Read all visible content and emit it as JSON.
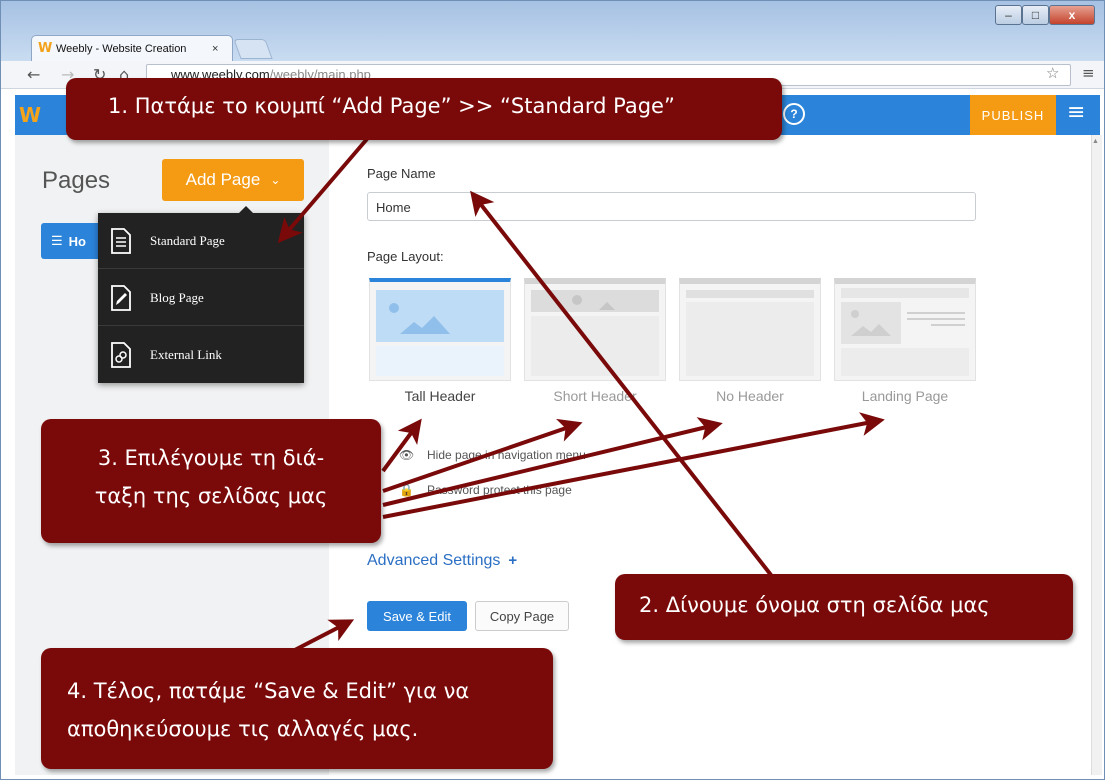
{
  "browser": {
    "tab_title": "Weebly - Website Creation",
    "tab_close": "×",
    "url_host": "www.weebly.com",
    "url_path": "/weebly/main.php",
    "window_controls": {
      "minimize": "–",
      "maximize": "□",
      "close": "x"
    }
  },
  "appbar": {
    "logo": "W",
    "help": "?",
    "publish_label": "PUBLISH",
    "menu_icon": "hamburger-icon"
  },
  "sidebar": {
    "title": "Pages",
    "add_page_label": "Add Page",
    "home_item_label": "Ho",
    "dropdown": [
      {
        "label": "Standard Page",
        "icon": "document-icon"
      },
      {
        "label": "Blog Page",
        "icon": "pencil-icon"
      },
      {
        "label": "External Link",
        "icon": "link-icon"
      }
    ]
  },
  "form": {
    "page_name_label": "Page Name",
    "page_name_value": "Home",
    "page_layout_label": "Page Layout:",
    "layouts": [
      {
        "label": "Tall Header",
        "selected": true
      },
      {
        "label": "Short Header",
        "selected": false
      },
      {
        "label": "No Header",
        "selected": false
      },
      {
        "label": "Landing Page",
        "selected": false
      }
    ],
    "hide_option": "Hide page in navigation menu",
    "password_option": "Password protect this page",
    "advanced_label": "Advanced Settings",
    "advanced_plus": "+",
    "save_label": "Save & Edit",
    "copy_label": "Copy Page"
  },
  "annotations": {
    "step1": "1.  Πατάμε το κουμπί “Add Page” >> “Standard Page”",
    "step2": "2. Δίνουμε όνομα στη σελίδα μας",
    "step3_line1": "3. Επιλέγουμε τη διά-",
    "step3_line2": "ταξη της σελίδας μας",
    "step4_line1": "4. Τέλος, πατάμε “Save & Edit” για να",
    "step4_line2": "αποθηκεύσουμε τις αλλαγές μας."
  },
  "colors": {
    "weebly_blue": "#2b84d9",
    "weebly_orange": "#f59a13",
    "callout_red": "#7a0a0a"
  }
}
